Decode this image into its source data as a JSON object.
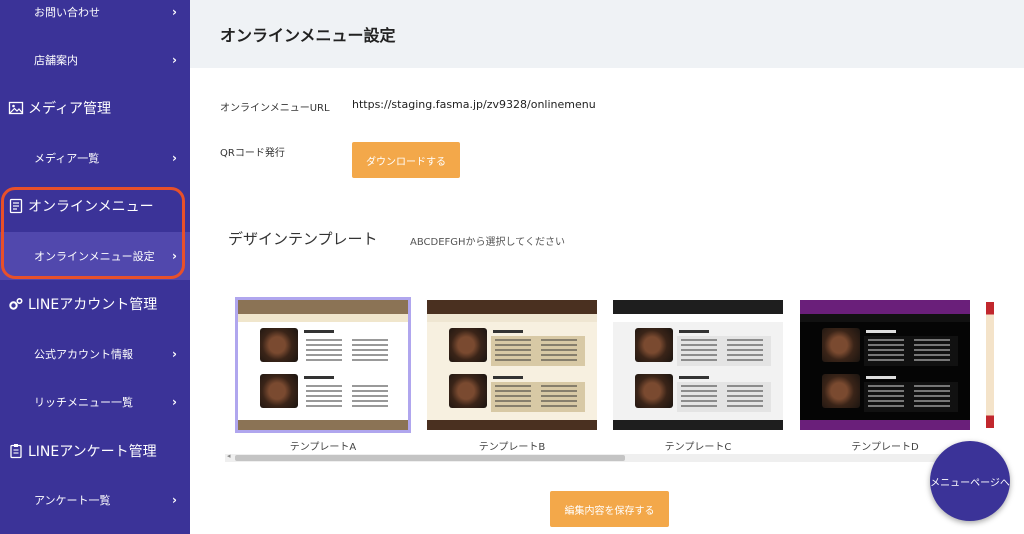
{
  "sidebar": {
    "items": [
      {
        "type": "sub",
        "label": "お問い合わせ",
        "chevron": "›"
      },
      {
        "type": "sub",
        "label": "店舗案内",
        "chevron": "›"
      },
      {
        "type": "head",
        "label": "メディア管理",
        "icon": "image-icon"
      },
      {
        "type": "sub",
        "label": "メディア一覧",
        "chevron": "›"
      },
      {
        "type": "head",
        "label": "オンラインメニュー",
        "icon": "menu-list-icon"
      },
      {
        "type": "sub",
        "label": "オンラインメニュー設定",
        "chevron": "›",
        "active": true
      },
      {
        "type": "head",
        "label": "LINEアカウント管理",
        "icon": "gears-icon"
      },
      {
        "type": "sub",
        "label": "公式アカウント情報",
        "chevron": "›"
      },
      {
        "type": "sub",
        "label": "リッチメニュー一覧",
        "chevron": "›"
      },
      {
        "type": "head",
        "label": "LINEアンケート管理",
        "icon": "clipboard-icon"
      },
      {
        "type": "sub",
        "label": "アンケート一覧",
        "chevron": "›"
      }
    ],
    "colors": {
      "background": "#3b3398",
      "active": "#5148ad",
      "highlight_border": "#e8502a"
    }
  },
  "main": {
    "title": "オンラインメニュー設定",
    "url_label": "オンラインメニューURL",
    "url_value": "https://staging.fasma.jp/zv9328/onlinemenu",
    "qr_label": "QRコード発行",
    "download_button": "ダウンロードする",
    "design_title": "デザインテンプレート",
    "design_hint": "ABCDEFGHから選択してください",
    "save_button": "編集内容を保存する",
    "fab_label": "メニューページへ",
    "accent": "#f3a84a"
  },
  "templates": [
    {
      "name": "テンプレートA",
      "selected": true,
      "head": "#8b7355",
      "tabs": "#f0e6cc",
      "body": "#ffffff",
      "foot": "#8b7355",
      "box": "#ffffff",
      "text": "#333"
    },
    {
      "name": "テンプレートB",
      "selected": false,
      "head": "#4a3020",
      "tabs": "#efe6d2",
      "body": "#f7f0e0",
      "foot": "#4a3020",
      "box": "#d8c9a5",
      "text": "#333"
    },
    {
      "name": "テンプレートC",
      "selected": false,
      "head": "#1e1e1e",
      "tabs": "#ffffff",
      "body": "#f2f2f2",
      "foot": "#1e1e1e",
      "box": "#e4e4e4",
      "text": "#333"
    },
    {
      "name": "テンプレートD",
      "selected": false,
      "head": "#6a1f7a",
      "tabs": "#111111",
      "body": "#050505",
      "foot": "#6a1f7a",
      "box": "#111111",
      "text": "#ddd"
    }
  ]
}
